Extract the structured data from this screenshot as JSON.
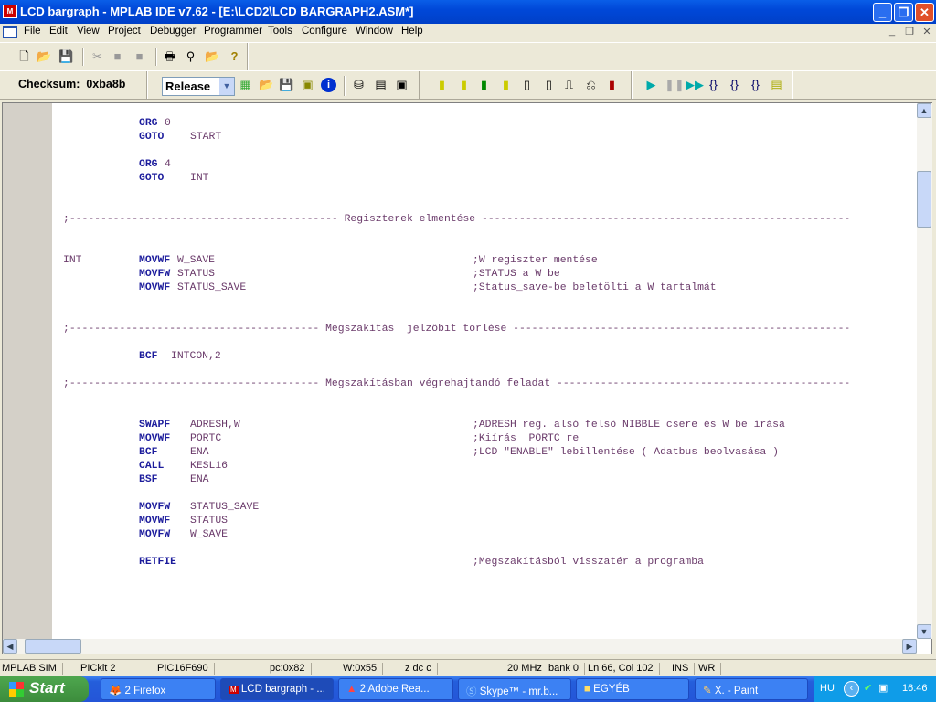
{
  "window": {
    "title": "LCD bargraph - MPLAB IDE v7.62 - [E:\\LCD2\\LCD BARGRAPH2.ASM*]",
    "minimize": "_",
    "restore": "❐",
    "close": "✕"
  },
  "menu": [
    "File",
    "Edit",
    "View",
    "Project",
    "Debugger",
    "Programmer",
    "Tools",
    "Configure",
    "Window",
    "Help"
  ],
  "toolbar": {
    "checksum_label": "Checksum:",
    "checksum_value": "0xba8b",
    "build_config": "Release"
  },
  "code": [
    {
      "op": "ORG",
      "arg": "0"
    },
    {
      "op": "GOTO",
      "arg": "START"
    },
    {
      "op": "ORG",
      "arg": "4"
    },
    {
      "op": "GOTO",
      "arg": "INT"
    },
    {
      "divider": ";------------------------------------------- Regiszterek elmentése -----------------------------------------------------------"
    },
    {
      "label": "INT",
      "op": "MOVWF",
      "arg": "W_SAVE",
      "comment": ";W regiszter mentése"
    },
    {
      "op": "MOVFW",
      "arg": "STATUS",
      "comment": ";STATUS a W be"
    },
    {
      "op": "MOVWF",
      "arg": "STATUS_SAVE",
      "comment": ";Status_save-be beletölti a W tartalmát"
    },
    {
      "divider": ";---------------------------------------- Megszakítás  jelzőbit törlése ------------------------------------------------------"
    },
    {
      "op": "BCF",
      "arg": "INTCON,2"
    },
    {
      "divider": ";---------------------------------------- Megszakításban végrehajtandó feladat -----------------------------------------------"
    },
    {
      "op": "SWAPF",
      "arg": "ADRESH,W",
      "comment": ";ADRESH reg. alsó felső NIBBLE csere és W be írása"
    },
    {
      "op": "MOVWF",
      "arg": "PORTC",
      "comment": ";Kiírás  PORTC re"
    },
    {
      "op": "BCF",
      "arg": "ENA",
      "comment": ";LCD \"ENABLE\" lebillentése ( Adatbus beolvasása )"
    },
    {
      "op": "CALL",
      "arg": "KESL16"
    },
    {
      "op": "BSF",
      "arg": "ENA"
    },
    {
      "op": "MOVFW",
      "arg": "STATUS_SAVE"
    },
    {
      "op": "MOVWF",
      "arg": "STATUS"
    },
    {
      "op": "MOVFW",
      "arg": "W_SAVE"
    },
    {
      "op": "RETFIE",
      "comment": ";Megszakításból visszatér a programba"
    }
  ],
  "status": [
    "MPLAB SIM",
    "PICkit 2",
    "PIC16F690",
    "pc:0x82",
    "W:0x55",
    "z dc c",
    "20 MHz",
    "bank 0",
    "Ln 66, Col 102",
    "INS",
    "WR"
  ],
  "taskbar": {
    "start": "Start",
    "tasks": [
      "2 Firefox",
      "LCD bargraph - ...",
      "2 Adobe Rea...",
      "Skype™ - mr.b...",
      "EGYÉB",
      "X. - Paint"
    ],
    "lang": "HU",
    "clock": "16:46"
  }
}
